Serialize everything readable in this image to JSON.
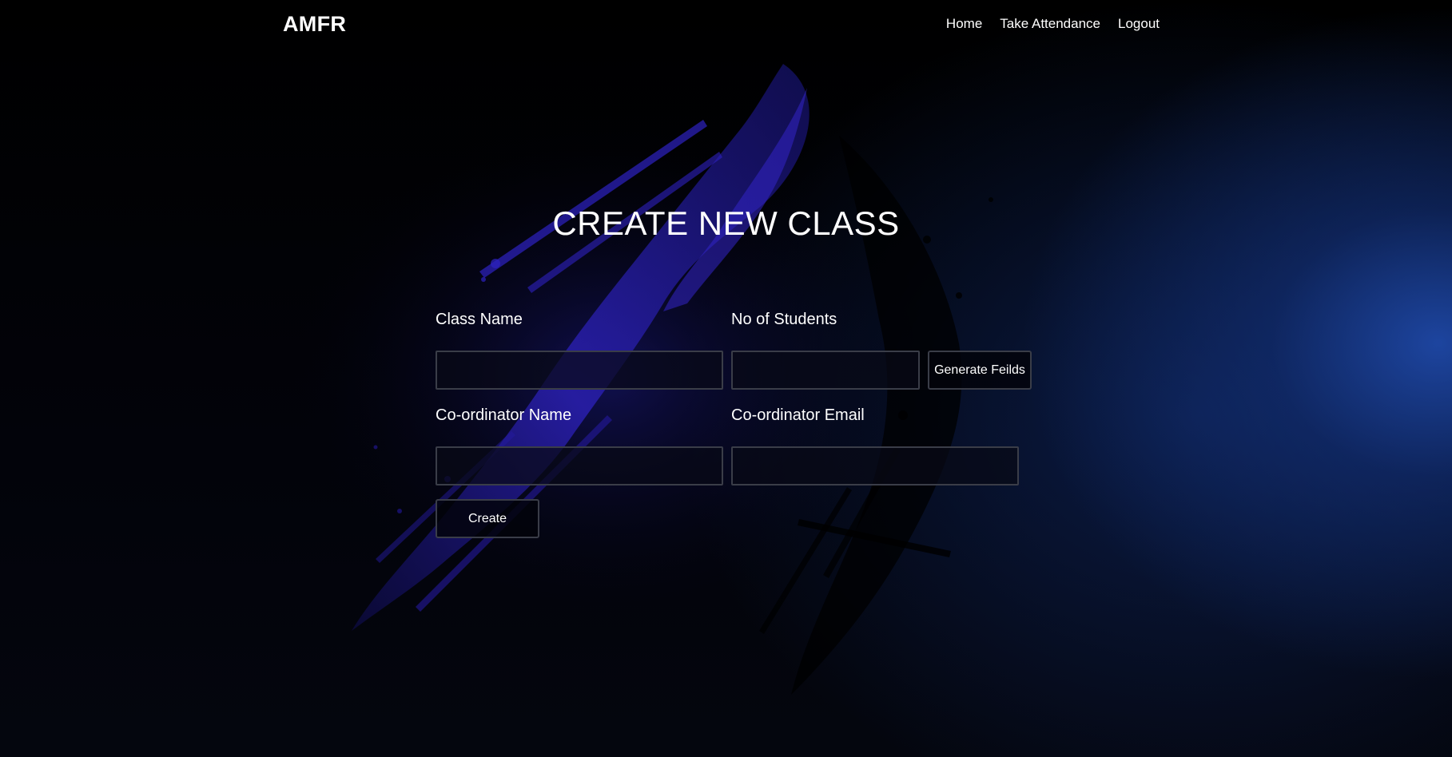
{
  "navbar": {
    "brand": "AMFR",
    "links": [
      "Home",
      "Take Attendance",
      "Logout"
    ]
  },
  "page_title": "CREATE NEW CLASS",
  "form": {
    "class_name_label": "Class Name",
    "class_name_value": "",
    "students_label": "No of Students",
    "students_value": "",
    "generate_button": "Generate Feilds",
    "coordinator_name_label": "Co-ordinator Name",
    "coordinator_name_value": "",
    "coordinator_email_label": "Co-ordinator Email",
    "coordinator_email_value": "",
    "create_button": "Create"
  },
  "colors": {
    "background": "#000000",
    "glow_blue": "#214eb4",
    "splash_violet": "#2a1fb0",
    "text": "#ffffff",
    "field_border": "#3a3d48"
  }
}
